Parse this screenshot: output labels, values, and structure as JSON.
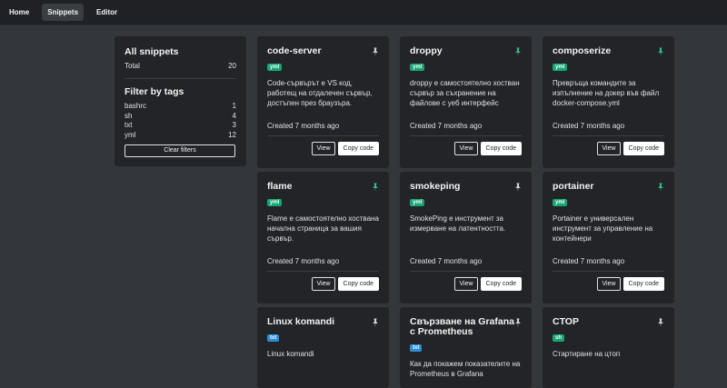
{
  "nav": {
    "home": "Home",
    "snippets": "Snippets",
    "editor": "Editor"
  },
  "sidebar": {
    "all_title": "All snippets",
    "total_label": "Total",
    "total_count": "20",
    "filter_title": "Filter by tags",
    "tags": [
      {
        "name": "bashrc",
        "count": "1"
      },
      {
        "name": "sh",
        "count": "4"
      },
      {
        "name": "txt",
        "count": "3"
      },
      {
        "name": "yml",
        "count": "12"
      }
    ],
    "clear_label": "Clear filters"
  },
  "colors": {
    "pinned": "#2fbf7f",
    "unpinned": "#cfd3d7",
    "yml": "#17a673",
    "txt": "#2b8fd6",
    "sh": "#17a673"
  },
  "buttons": {
    "view": "View",
    "copy": "Copy code"
  },
  "cards": [
    {
      "title": "code-server",
      "tag": "yml",
      "pinned": false,
      "icon": "pin-icon",
      "desc": "Code-сървърът е VS код, работещ на отдалечен сървър, достъпен през браузъра.",
      "created": "Created 7 months ago"
    },
    {
      "title": "droppy",
      "tag": "yml",
      "pinned": true,
      "icon": "pin-icon",
      "desc": "droppy е самостоятелно хостван сървър за съхранение на файлове с уеб интерфейс",
      "created": "Created 7 months ago"
    },
    {
      "title": "composerize",
      "tag": "yml",
      "pinned": true,
      "icon": "pin-icon",
      "desc": "Превръща командите за изпълнение на докер във файл docker-compose.yml",
      "created": "Created 7 months ago"
    },
    {
      "title": "flame",
      "tag": "yml",
      "pinned": true,
      "icon": "pin-icon",
      "desc": "Flame е самостоятелно хоствана начална страница за вашия сървър.",
      "created": "Created 7 months ago"
    },
    {
      "title": "smokeping",
      "tag": "yml",
      "pinned": false,
      "icon": "pin-icon",
      "desc": "SmokePing е инструмент за измерване на латентността.",
      "created": "Created 7 months ago"
    },
    {
      "title": "portainer",
      "tag": "yml",
      "pinned": true,
      "icon": "pin-icon",
      "desc": "Portainer е универсален инструмент за управление на контейнери",
      "created": "Created 7 months ago"
    },
    {
      "title": "Linux komandi",
      "tag": "txt",
      "pinned": false,
      "icon": "pin-icon",
      "desc": "Linux komandi",
      "created": ""
    },
    {
      "title": "Свързване на Grafana с Prometheus",
      "tag": "txt",
      "pinned": false,
      "icon": "pin-icon",
      "desc": "Как да покажем показателите на Prometheus в Grafana",
      "created": ""
    },
    {
      "title": "CTOP",
      "tag": "sh",
      "pinned": false,
      "icon": "pin-icon",
      "desc": "Стартиране на цтоп",
      "created": ""
    }
  ]
}
